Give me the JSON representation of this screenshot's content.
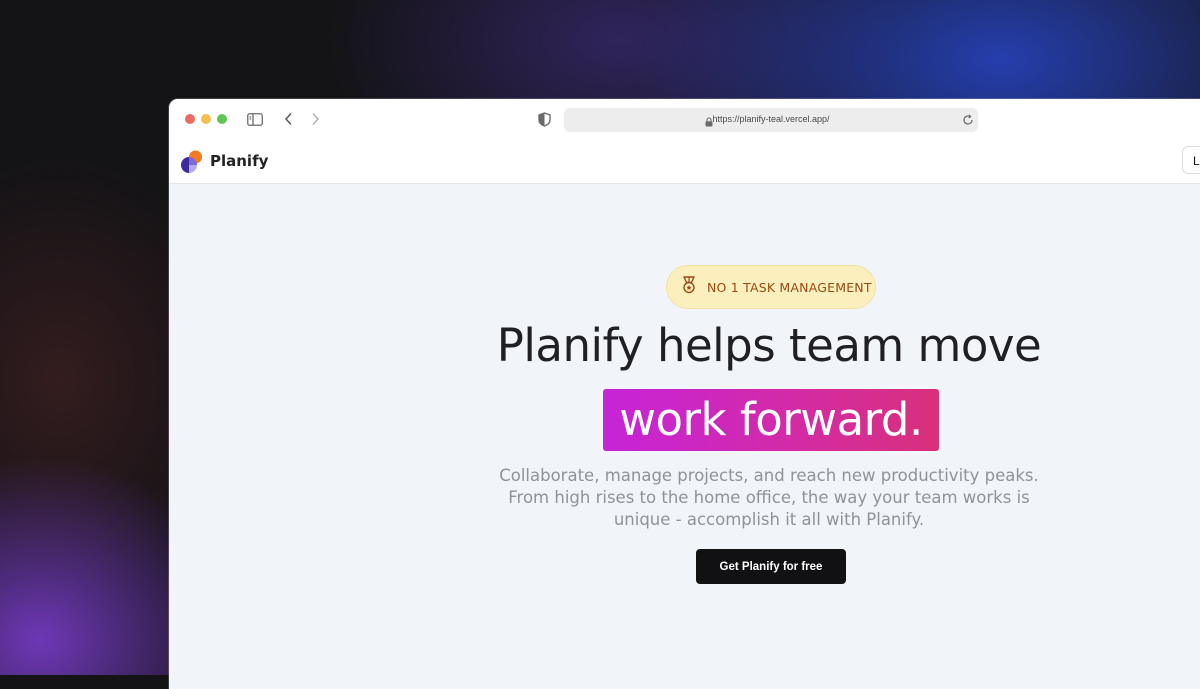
{
  "browser": {
    "url": "https://planify-teal.vercel.app/",
    "icons": [
      "sidebar-icon",
      "back-icon",
      "forward-icon",
      "shield-icon",
      "lock-icon",
      "reload-icon"
    ]
  },
  "navbar": {
    "brand": "Planify",
    "login_label": "L"
  },
  "hero": {
    "badge": "NO 1 TASK MANAGEMENT",
    "headline": "Planify helps team move",
    "highlight": "work forward.",
    "subtitle_lines": [
      "Collaborate, manage projects, and reach new productivity peaks.",
      "From high rises to the home office, the way your team works is",
      "unique - accomplish it all with Planify."
    ],
    "cta_label": "Get Planify for free"
  },
  "colors": {
    "badge_bg": "#fbefbe",
    "badge_text": "#9a4a14",
    "highlight_start": "#c624d9",
    "highlight_end": "#d8307a",
    "cta_bg": "#111113"
  }
}
